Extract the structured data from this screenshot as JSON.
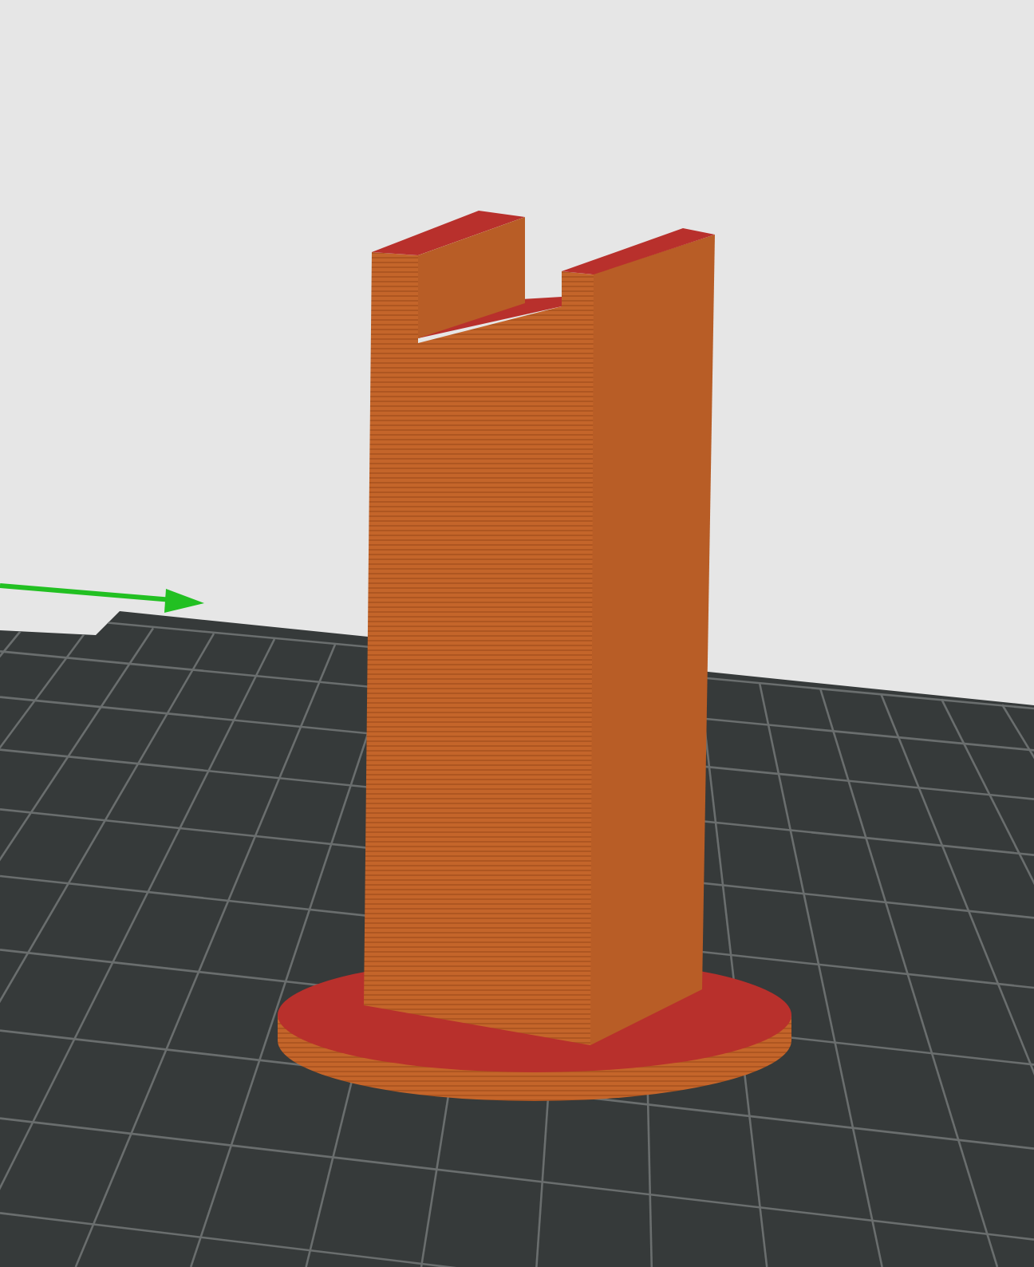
{
  "viewport": {
    "kind": "layer-preview"
  }
}
